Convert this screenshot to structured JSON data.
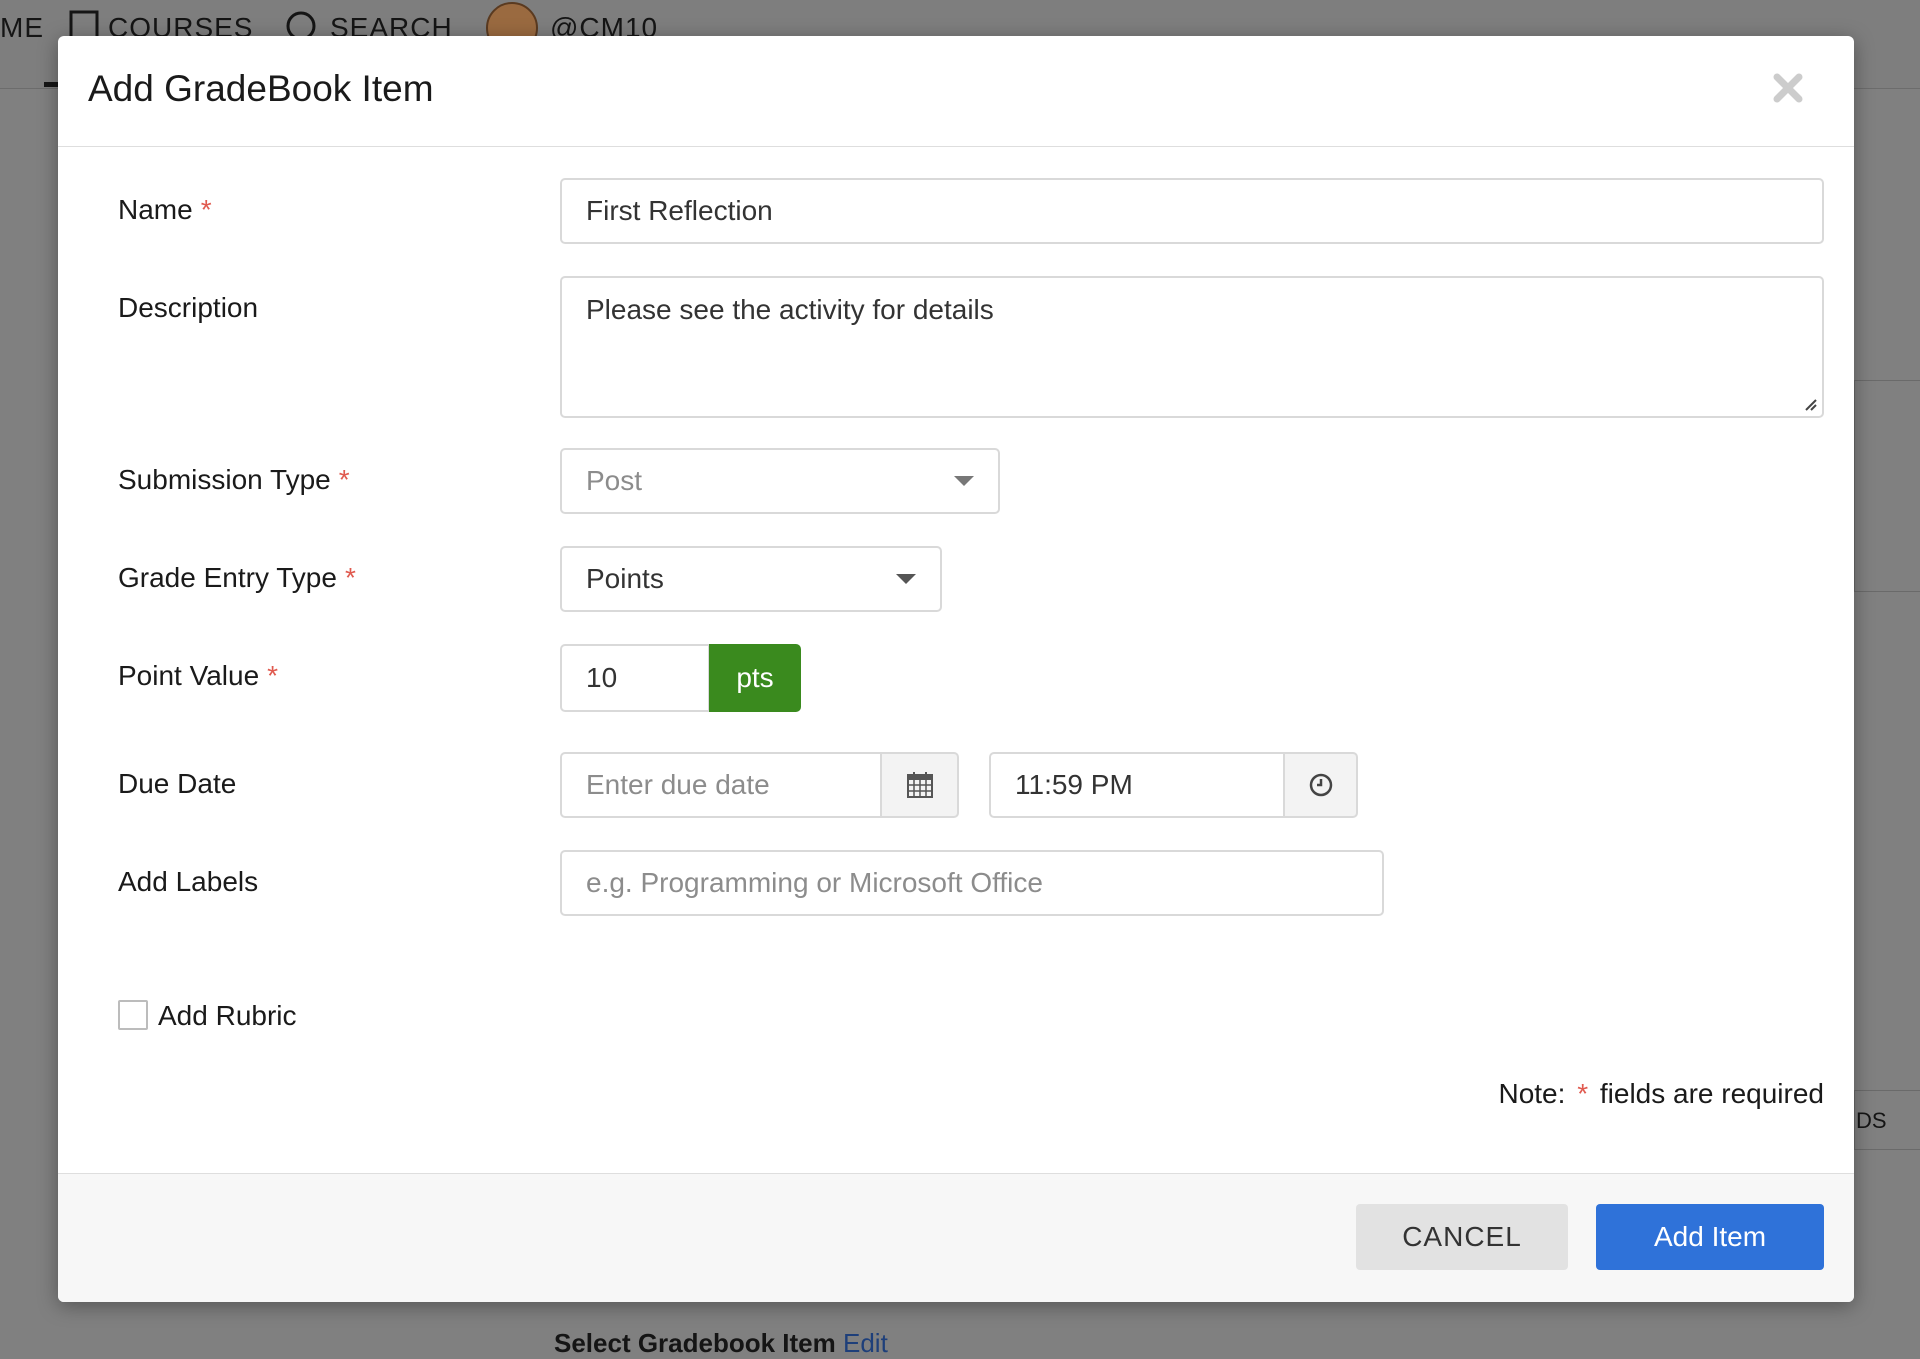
{
  "background": {
    "nav": {
      "partial_home_label": "ME",
      "courses_label": "COURSES",
      "search_label": "SEARCH",
      "user_handle": "@CM10"
    },
    "footer": {
      "select_label": "Select Gradebook Item",
      "edit_link": "Edit"
    },
    "side_fragment": "DS"
  },
  "modal": {
    "title": "Add GradeBook Item",
    "close_icon": "close-x-icon",
    "required_mark": "*",
    "fields": {
      "name": {
        "label": "Name",
        "value": "First Reflection"
      },
      "description": {
        "label": "Description",
        "value": "Please see the activity for details"
      },
      "submission_type": {
        "label": "Submission Type",
        "value": "Post",
        "disabled": true
      },
      "grade_entry_type": {
        "label": "Grade Entry Type",
        "value": "Points"
      },
      "point_value": {
        "label": "Point Value",
        "value": "10",
        "unit": "pts"
      },
      "due_date": {
        "label": "Due Date",
        "date_placeholder": "Enter due date",
        "time_value": "11:59 PM",
        "date_icon": "calendar-icon",
        "time_icon": "clock-icon"
      },
      "labels": {
        "label": "Add Labels",
        "placeholder": "e.g. Programming or Microsoft Office"
      }
    },
    "rubric": {
      "label": "Add Rubric",
      "checked": false
    },
    "note": {
      "prefix": "Note:",
      "suffix": "fields are required"
    },
    "buttons": {
      "cancel": "CANCEL",
      "submit": "Add Item"
    }
  },
  "colors": {
    "primary_button": "#2f72d9",
    "pts_addon": "#3a8a1e",
    "required_asterisk": "#e05a4f",
    "overlay": "#808080"
  }
}
